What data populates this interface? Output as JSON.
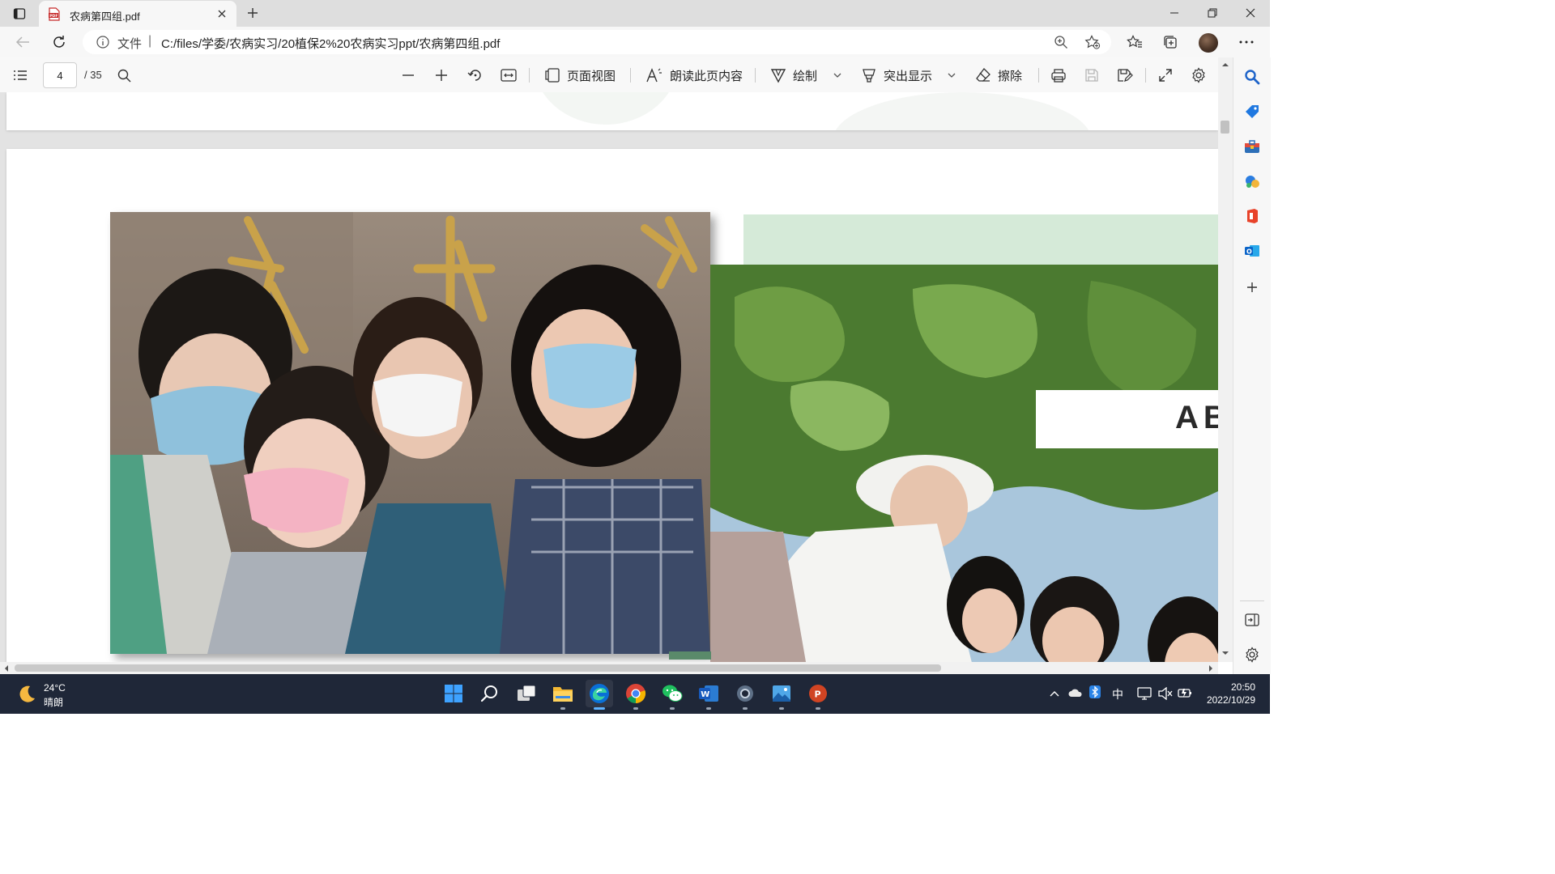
{
  "browser": {
    "tab_title": "农病第四组.pdf",
    "address_scheme": "文件",
    "address_separator": "|",
    "url": "C:/files/学委/农病实习/20植保2%20农病实习ppt/农病第四组.pdf"
  },
  "pdf_toolbar": {
    "current_page": "4",
    "page_count": "/ 35",
    "page_view_label": "页面视图",
    "read_aloud_label": "朗读此页内容",
    "draw_label": "绘制",
    "highlight_label": "突出显示",
    "erase_label": "擦除"
  },
  "document": {
    "slide_title_partial": "AB"
  },
  "sidebar": {
    "icons": [
      "search-icon",
      "shopping-tag-icon",
      "toolbox-icon",
      "games-icon",
      "office-icon",
      "outlook-icon",
      "add-icon",
      "hide-sidebar-icon",
      "settings-icon"
    ]
  },
  "taskbar": {
    "temperature": "24°C",
    "weather_condition": "晴朗",
    "ime_label": "中",
    "time": "20:50",
    "date": "2022/10/29",
    "apps": [
      "start",
      "search",
      "task-view",
      "file-explorer",
      "edge",
      "chrome",
      "wechat",
      "word",
      "settings",
      "photos",
      "powerpoint"
    ]
  },
  "colors": {
    "tab_strip": "#dedede",
    "toolbar": "#f8f8f8",
    "taskbar": "#1f2738",
    "slide_green": "#d5ead8",
    "edge_blue": "#0a6fd6"
  }
}
